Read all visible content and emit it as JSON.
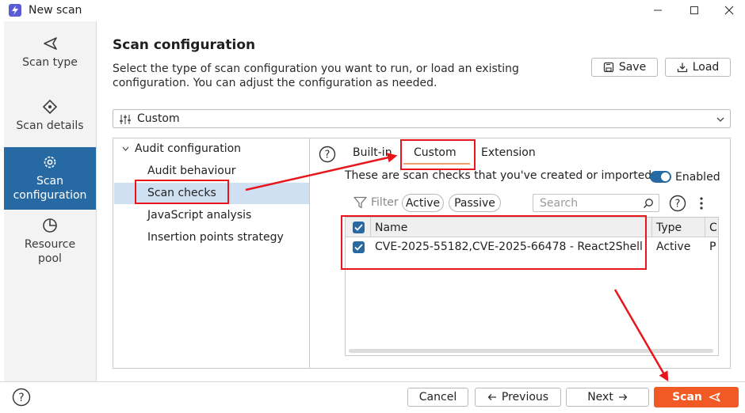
{
  "window": {
    "title": "New scan"
  },
  "nav": [
    {
      "label": "Scan type",
      "icon": "send-icon"
    },
    {
      "label": "Scan details",
      "icon": "target-icon"
    },
    {
      "label": "Scan configuration",
      "icon": "gear-icon",
      "active": true
    },
    {
      "label": "Resource pool",
      "icon": "pie-icon"
    }
  ],
  "header": {
    "title": "Scan configuration",
    "description": "Select the type of scan configuration you want to run, or load an existing configuration. You can adjust the configuration as needed.",
    "save_label": "Save",
    "load_label": "Load"
  },
  "config_select": {
    "value": "Custom"
  },
  "tree": {
    "root": "Audit configuration",
    "items": [
      "Audit behaviour",
      "Scan checks",
      "JavaScript analysis",
      "Insertion points strategy"
    ],
    "selected": "Scan checks"
  },
  "tabs": [
    {
      "label": "Built-in"
    },
    {
      "label": "Custom",
      "active": true
    },
    {
      "label": "Extension"
    }
  ],
  "custom_tab": {
    "info": "These are scan checks that you've created or imported.",
    "enabled_label": "Enabled",
    "filter_label": "Filter",
    "filter_active": "Active",
    "filter_passive": "Passive",
    "search_placeholder": "Search"
  },
  "table": {
    "columns": [
      "Name",
      "Type",
      "C"
    ],
    "rows": [
      {
        "checked": true,
        "name": "CVE-2025-55182,CVE-2025-66478 - React2Shell",
        "type": "Active",
        "c": "P"
      }
    ]
  },
  "footer": {
    "cancel_label": "Cancel",
    "previous_label": "Previous",
    "next_label": "Next",
    "scan_label": "Scan"
  },
  "colors": {
    "accent": "#276aa3",
    "scan_button": "#f15a24",
    "annotation": "#e8161c"
  }
}
